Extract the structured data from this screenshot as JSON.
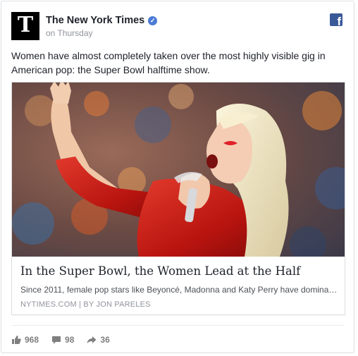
{
  "post": {
    "page_name": "The New York Times",
    "logo_glyph": "T",
    "timestamp": "on Thursday",
    "verified_glyph": "✓",
    "fb_glyph": "f",
    "text": "Women have almost completely taken over the most highly visible gig in American pop: the Super Bowl halftime show."
  },
  "link": {
    "title": "In the Super Bowl, the Women Lead at the Half",
    "description": "Since 2011, female pop stars like Beyoncé, Madonna and Katy Perry have dominated...",
    "source": "NYTIMES.COM | BY JON PARELES"
  },
  "stats": {
    "likes": "968",
    "comments": "98",
    "shares": "36"
  },
  "colors": {
    "brand_blue": "#3b5998",
    "verified_blue": "#4b7bd6",
    "text_primary": "#1d2129",
    "text_secondary": "#90949c"
  },
  "icons": {
    "like": "thumbs-up-icon",
    "comment": "comment-bubble-icon",
    "share": "share-arrow-icon",
    "facebook": "facebook-icon"
  }
}
